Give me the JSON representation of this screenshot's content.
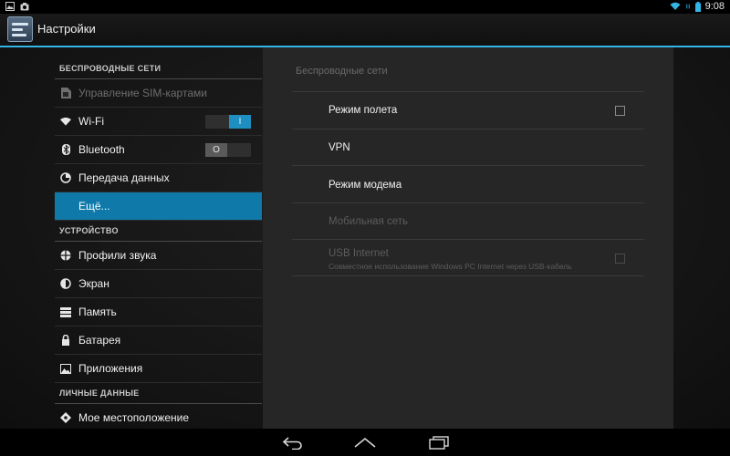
{
  "status_bar": {
    "time": "9:08",
    "left_icons": [
      "image-notification-icon",
      "camera-notification-icon"
    ],
    "right_icons": [
      "wifi-icon",
      "data-icon",
      "battery-icon"
    ]
  },
  "action_bar": {
    "title": "Настройки",
    "icon": "settings-app-icon"
  },
  "sidebar": {
    "categories": [
      {
        "label": "БЕСПРОВОДНЫЕ СЕТИ",
        "items": [
          {
            "label": "Управление SIM-картами",
            "icon": "sim-icon",
            "disabled": true
          },
          {
            "label": "Wi-Fi",
            "icon": "wifi-icon",
            "toggle": "on",
            "toggle_label": "I"
          },
          {
            "label": "Bluetooth",
            "icon": "bluetooth-icon",
            "toggle": "off",
            "toggle_label": "O"
          },
          {
            "label": "Передача данных",
            "icon": "data-usage-icon"
          },
          {
            "label": "Ещё...",
            "icon": "",
            "selected": true
          }
        ]
      },
      {
        "label": "УСТРОЙСТВО",
        "items": [
          {
            "label": "Профили звука",
            "icon": "sound-profile-icon"
          },
          {
            "label": "Экран",
            "icon": "display-icon"
          },
          {
            "label": "Память",
            "icon": "storage-icon"
          },
          {
            "label": "Батарея",
            "icon": "battery-icon"
          },
          {
            "label": "Приложения",
            "icon": "apps-icon"
          }
        ]
      },
      {
        "label": "ЛИЧНЫЕ ДАННЫЕ",
        "items": [
          {
            "label": "Мое местоположение",
            "icon": "location-icon"
          }
        ]
      }
    ]
  },
  "panel": {
    "header": "Беспроводные сети",
    "items": [
      {
        "label": "Режим полета",
        "checkbox": true,
        "checked": false
      },
      {
        "label": "VPN"
      },
      {
        "label": "Режим модема"
      },
      {
        "label": "Мобильная сеть",
        "disabled": true
      },
      {
        "label": "USB Internet",
        "summary": "Совместное использование Windows PC Internet через USB-кабель",
        "checkbox": true,
        "checked": false,
        "disabled": true
      }
    ]
  },
  "nav_bar": {
    "buttons": [
      "back-icon",
      "home-icon",
      "recent-apps-icon"
    ]
  },
  "colors": {
    "accent": "#33b5e5",
    "selected": "#0f7aaa",
    "panel_bg": "#262626"
  }
}
